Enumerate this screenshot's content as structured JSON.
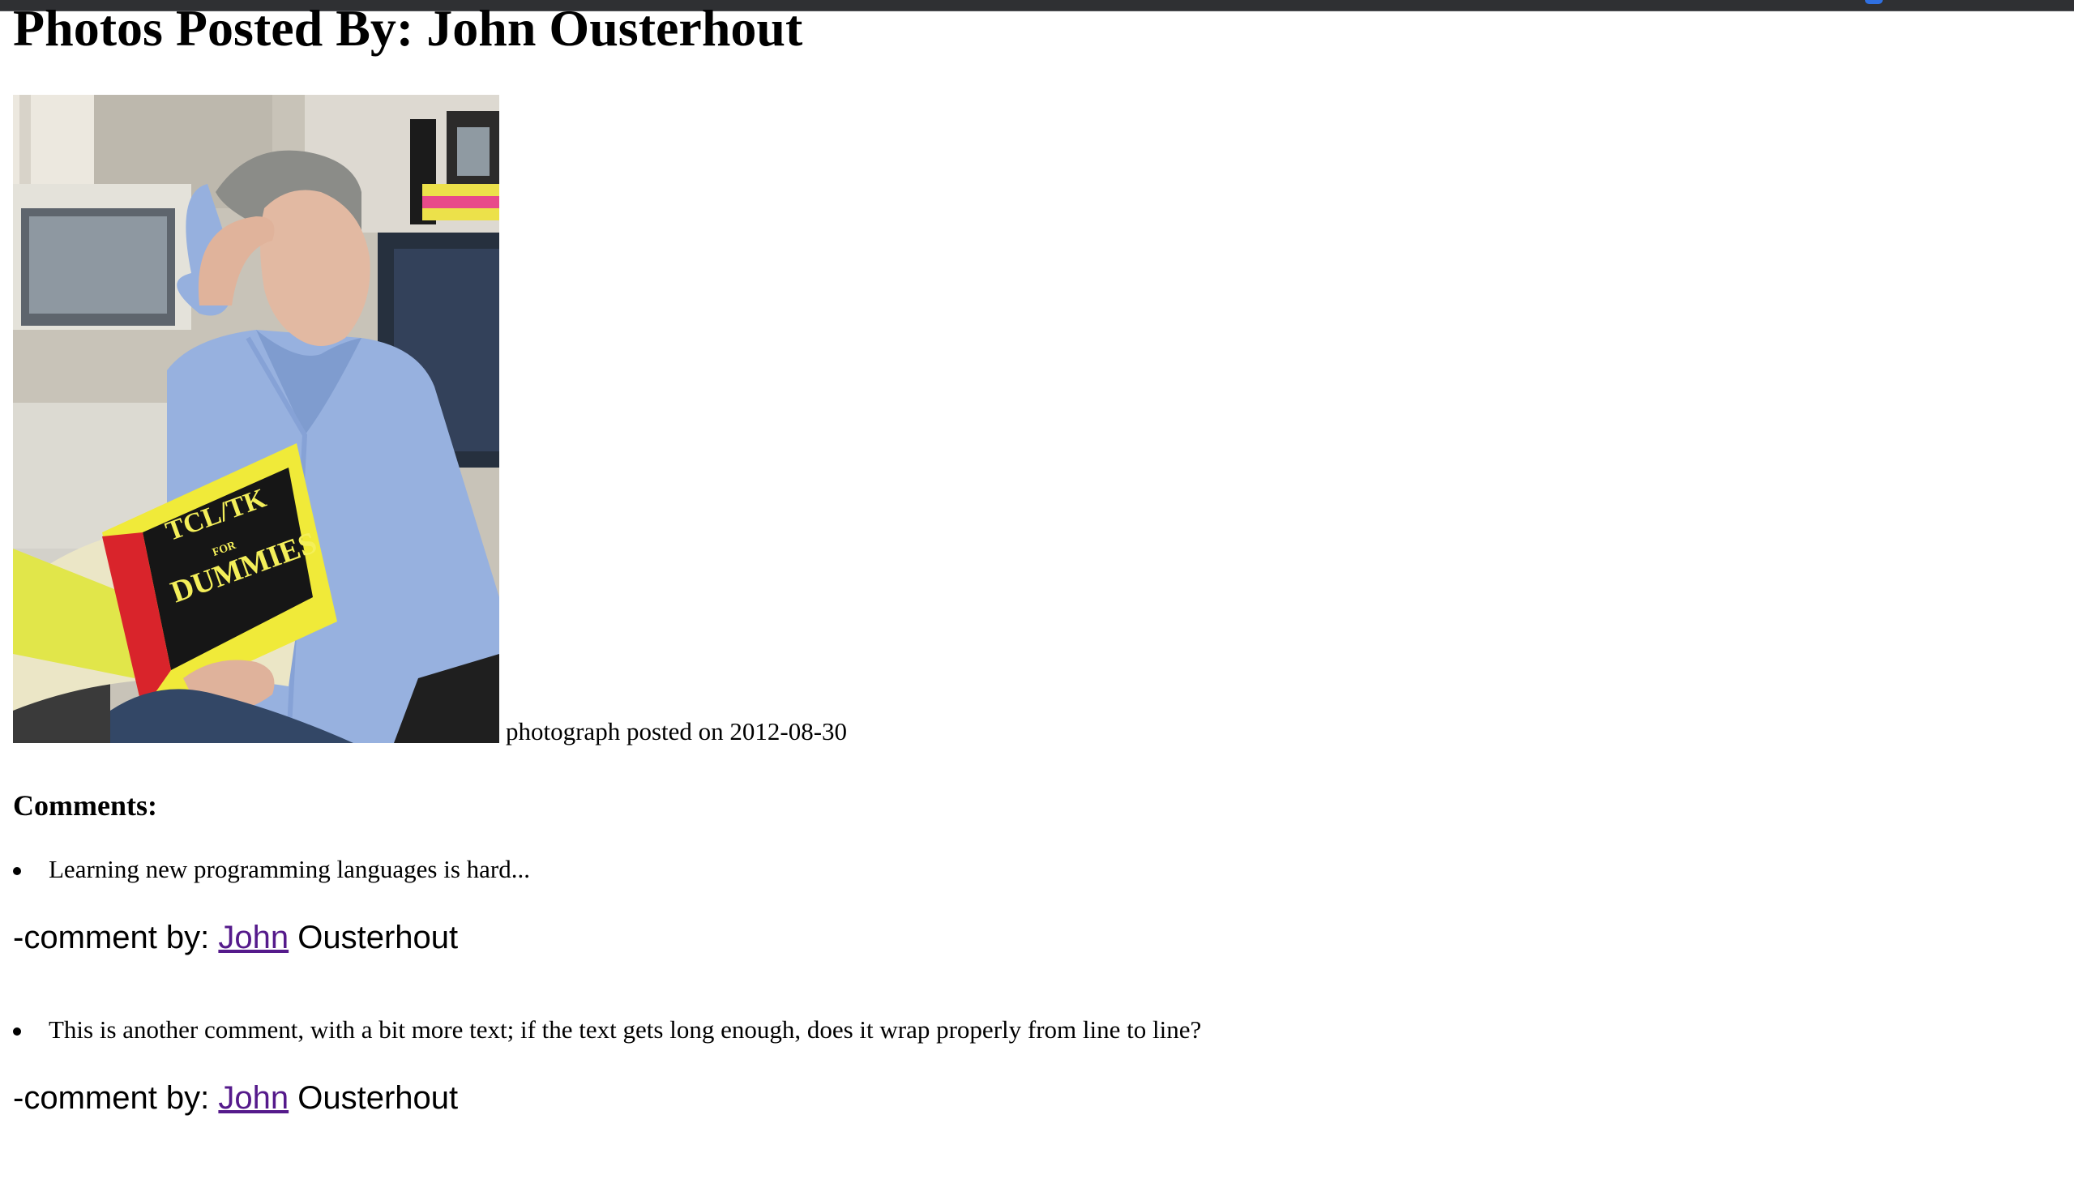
{
  "page": {
    "title": "Photos Posted By: John Ousterhout"
  },
  "photo": {
    "alt": "John Ousterhout reading TCL/TK for Dummies",
    "book_title_line1": "TCL/TK",
    "book_title_line2": "FOR",
    "book_title_line3": "DUMMIES",
    "caption": "photograph posted on 2012-08-30"
  },
  "comments": {
    "heading": "Comments:",
    "items": [
      {
        "text": "Learning new programming languages is hard...",
        "prefix": "-comment by: ",
        "author_link": "John",
        "author_rest": " Ousterhout"
      },
      {
        "text": "This is another comment, with a bit more text; if the text gets long enough, does it wrap properly from line to line?",
        "prefix": "-comment by: ",
        "author_link": "John",
        "author_rest": " Ousterhout"
      }
    ]
  },
  "colors": {
    "visited_link": "#551a8b",
    "top_bar": "#2f3033",
    "top_bar_indicator": "#2f6fe0"
  }
}
